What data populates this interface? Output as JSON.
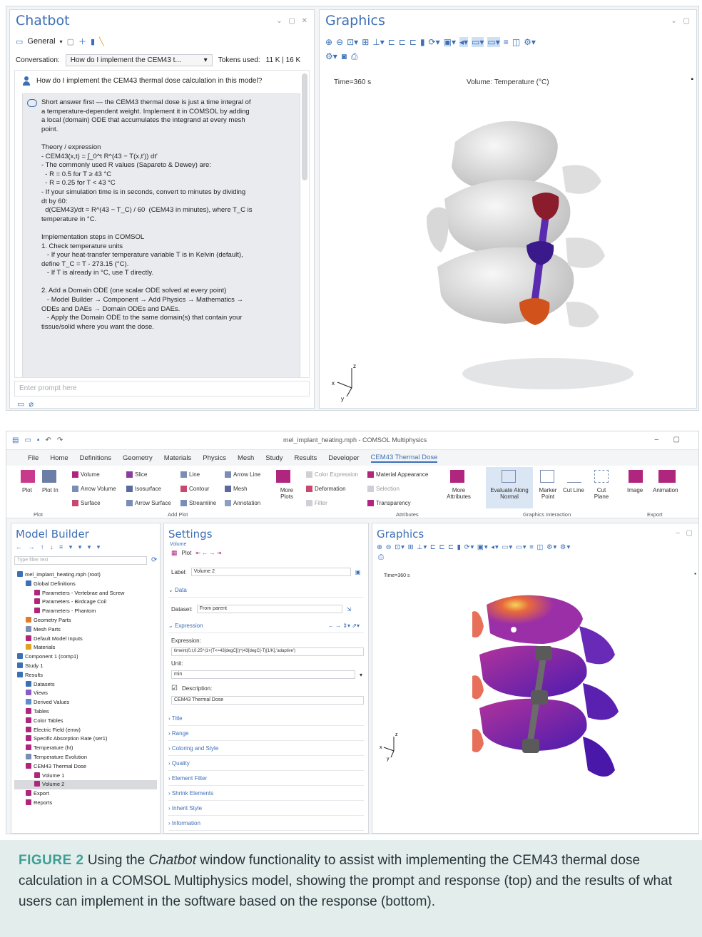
{
  "top": {
    "chatbot": {
      "title": "Chatbot",
      "general_label": "General",
      "conversation_label": "Conversation:",
      "conversation_value": "How do I implement the CEM43 t...",
      "tokens_label": "Tokens used:",
      "tokens_value": "11 K | 16 K",
      "user_message": "How do I implement the CEM43 thermal dose calculation in this model?",
      "response_lines": [
        "Short answer first — the CEM43 thermal dose is just a time integral of",
        "a temperature-dependent weight. Implement it in COMSOL by adding",
        "a local (domain) ODE that accumulates the integrand at every mesh",
        "point.",
        "",
        "Theory / expression",
        "- CEM43(x,t) = ∫_0^t R^(43 − T(x,t')) dt'",
        "- The commonly used R values (Sapareto & Dewey) are:",
        "  - R = 0.5 for T ≥ 43 °C",
        "  - R = 0.25 for T < 43 °C",
        "- If your simulation time is in seconds, convert to minutes by dividing",
        "dt by 60:",
        "  d(CEM43)/dt = R^(43 − T_C) / 60  (CEM43 in minutes), where T_C is",
        "temperature in °C.",
        "",
        "Implementation steps in COMSOL",
        "1. Check temperature units",
        "   - If your heat-transfer temperature variable T is in Kelvin (default),",
        "define T_C = T - 273.15 (°C).",
        "   - If T is already in °C, use T directly.",
        "",
        "2. Add a Domain ODE (one scalar ODE solved at every point)",
        "   - Model Builder → Component → Add Physics → Mathematics →",
        "ODEs and DAEs → Domain ODEs and DAEs.",
        "   - Apply the Domain ODE to the same domain(s) that contain your",
        "tissue/solid where you want the dose."
      ],
      "prompt_placeholder": "Enter prompt here"
    },
    "graphics": {
      "title": "Graphics",
      "time_label": "Time=360 s",
      "volume_label": "Volume: Temperature (°C)"
    }
  },
  "bottom": {
    "window_title": "mel_implant_heating.mph - COMSOL Multiphysics",
    "menu": [
      "File",
      "Home",
      "Definitions",
      "Geometry",
      "Materials",
      "Physics",
      "Mesh",
      "Study",
      "Results",
      "Developer",
      "CEM43 Thermal Dose"
    ],
    "ribbon": {
      "plot": "Plot",
      "plot_in": "Plot In",
      "volume": "Volume",
      "slice": "Slice",
      "line": "Line",
      "arrow_line": "Arrow Line",
      "arrow_volume": "Arrow Volume",
      "isosurface": "Isosurface",
      "contour": "Contour",
      "mesh": "Mesh",
      "more_plots": "More Plots",
      "surface": "Surface",
      "arrow_surface": "Arrow Surface",
      "streamline": "Streamline",
      "annotation": "Annotation",
      "color_expression": "Color Expression",
      "material_appearance": "Material Appearance",
      "deformation": "Deformation",
      "selection": "Selection",
      "filter": "Filter",
      "transparency": "Transparency",
      "more_attributes": "More Attributes",
      "evaluate": "Evaluate Along Normal",
      "marker_point": "Marker Point",
      "cut_line": "Cut Line",
      "cut_plane": "Cut Plane",
      "image": "Image",
      "animation": "Animation",
      "groups": [
        "Plot",
        "Add Plot",
        "Attributes",
        "Graphics Interaction",
        "Export"
      ]
    },
    "model_builder": {
      "title": "Model Builder",
      "filter_placeholder": "Type filter text",
      "tree": [
        "mel_implant_heating.mph (root)",
        "Global Definitions",
        "Parameters - Vertebrae and Screw",
        "Parameters - Birdcage Coil",
        "Parameters - Phantom",
        "Geometry Parts",
        "Mesh Parts",
        "Default Model Inputs",
        "Materials",
        "Component 1 (comp1)",
        "Study 1",
        "Results",
        "Datasets",
        "Views",
        "Derived Values",
        "Tables",
        "Color Tables",
        "Electric Field (emw)",
        "Specific Absorption Rate (ser1)",
        "Temperature (ht)",
        "Temperature Evolution",
        "CEM43 Thermal Dose",
        "Volume 1",
        "Volume 2",
        "Export",
        "Reports"
      ]
    },
    "settings": {
      "title": "Settings",
      "subtitle": "Volume",
      "plot_label": "Plot",
      "label_field": "Label:",
      "label_value": "Volume 2",
      "data_section": "Data",
      "dataset_label": "Dataset:",
      "dataset_value": "From parent",
      "expression_section": "Expression",
      "expression_label": "Expression:",
      "expression_value": "timeint(0,t,0.25^(1+(T<=43[degC]))^(43[degC]-T)[1/K],'adaptive')",
      "unit_label": "Unit:",
      "unit_value": "min",
      "description_label": "Description:",
      "description_value": "CEM43 Thermal Dose",
      "sections": [
        "Title",
        "Range",
        "Coloring and Style",
        "Quality",
        "Element Filter",
        "Shrink Elements",
        "Inherit Style",
        "Information"
      ]
    },
    "graphics": {
      "title": "Graphics",
      "time_label": "Time=360 s"
    }
  },
  "caption": {
    "figure_label": "FIGURE 2",
    "text_before": " Using the ",
    "italic": "Chatbot",
    "text_after": " window functionality to assist with implementing the CEM43 thermal dose calculation in a COMSOL Multiphysics model, showing the prompt and response (top) and the results of what users can implement in the software based on the response (bottom)."
  },
  "colors": {
    "accent_blue": "#3d6fb6",
    "caption_bg": "#e3eeec",
    "caption_label": "#3e9e95",
    "dose_magenta": "#9b2fa8",
    "dose_yellow": "#f7d35a"
  }
}
